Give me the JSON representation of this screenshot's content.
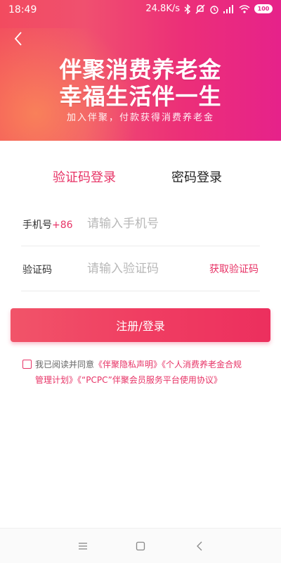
{
  "status_bar": {
    "time": "18:49",
    "speed": "24.8K/s",
    "battery": "100"
  },
  "hero": {
    "title_line1": "伴聚消费养老金",
    "title_line2": "幸福生活伴一生",
    "subtitle": "加入伴聚，付款获得消费养老金"
  },
  "tabs": {
    "sms_login": "验证码登录",
    "password_login": "密码登录"
  },
  "form": {
    "phone_label": "手机号",
    "country_code": "+86",
    "phone_placeholder": "请输入手机号",
    "code_label": "验证码",
    "code_placeholder": "请输入验证码",
    "get_code": "获取验证码"
  },
  "submit_label": "注册/登录",
  "agreement": {
    "prefix": "我已阅读并同意",
    "link1": "《伴聚隐私声明》《个人消费养老金合规",
    "link2": "管理计划》《“PCPC”伴聚会员服务平台使用协议》"
  },
  "colors": {
    "accent": "#e73366",
    "hero_start": "#f24b5f",
    "hero_end": "#e6228a"
  }
}
